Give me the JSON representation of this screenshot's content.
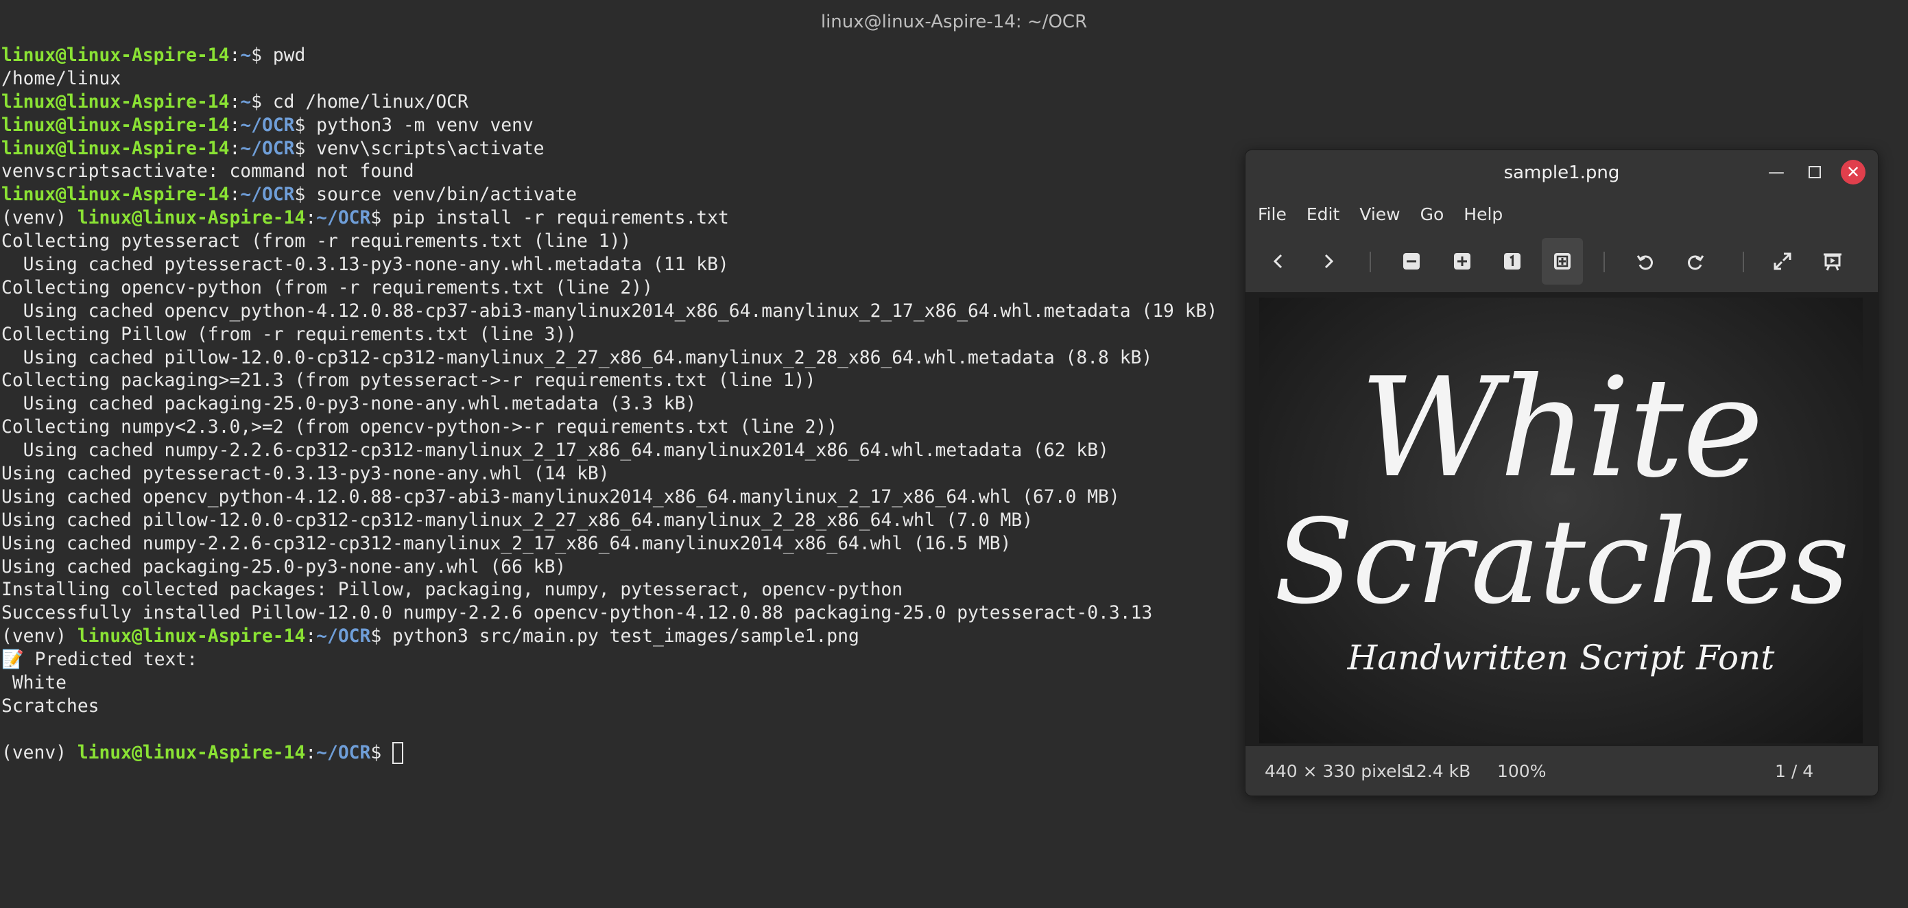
{
  "terminal": {
    "title": "linux@linux-Aspire-14: ~/OCR",
    "lines": [
      {
        "pre": "",
        "user": "linux@linux-Aspire-14",
        "path": "~",
        "cmd": "$ pwd"
      },
      {
        "text": "/home/linux"
      },
      {
        "pre": "",
        "user": "linux@linux-Aspire-14",
        "path": "~",
        "cmd": "$ cd /home/linux/OCR"
      },
      {
        "pre": "",
        "user": "linux@linux-Aspire-14",
        "path": "~/OCR",
        "cmd": "$ python3 -m venv venv"
      },
      {
        "pre": "",
        "user": "linux@linux-Aspire-14",
        "path": "~/OCR",
        "cmd": "$ venv\\scripts\\activate"
      },
      {
        "text": "venvscriptsactivate: command not found"
      },
      {
        "pre": "",
        "user": "linux@linux-Aspire-14",
        "path": "~/OCR",
        "cmd": "$ source venv/bin/activate"
      },
      {
        "pre": "(venv) ",
        "user": "linux@linux-Aspire-14",
        "path": "~/OCR",
        "cmd": "$ pip install -r requirements.txt"
      },
      {
        "text": "Collecting pytesseract (from -r requirements.txt (line 1))"
      },
      {
        "text": "  Using cached pytesseract-0.3.13-py3-none-any.whl.metadata (11 kB)"
      },
      {
        "text": "Collecting opencv-python (from -r requirements.txt (line 2))"
      },
      {
        "text": "  Using cached opencv_python-4.12.0.88-cp37-abi3-manylinux2014_x86_64.manylinux_2_17_x86_64.whl.metadata (19 kB)"
      },
      {
        "text": "Collecting Pillow (from -r requirements.txt (line 3))"
      },
      {
        "text": "  Using cached pillow-12.0.0-cp312-cp312-manylinux_2_27_x86_64.manylinux_2_28_x86_64.whl.metadata (8.8 kB)"
      },
      {
        "text": "Collecting packaging>=21.3 (from pytesseract->-r requirements.txt (line 1))"
      },
      {
        "text": "  Using cached packaging-25.0-py3-none-any.whl.metadata (3.3 kB)"
      },
      {
        "text": "Collecting numpy<2.3.0,>=2 (from opencv-python->-r requirements.txt (line 2))"
      },
      {
        "text": "  Using cached numpy-2.2.6-cp312-cp312-manylinux_2_17_x86_64.manylinux2014_x86_64.whl.metadata (62 kB)"
      },
      {
        "text": "Using cached pytesseract-0.3.13-py3-none-any.whl (14 kB)"
      },
      {
        "text": "Using cached opencv_python-4.12.0.88-cp37-abi3-manylinux2014_x86_64.manylinux_2_17_x86_64.whl (67.0 MB)"
      },
      {
        "text": "Using cached pillow-12.0.0-cp312-cp312-manylinux_2_27_x86_64.manylinux_2_28_x86_64.whl (7.0 MB)"
      },
      {
        "text": "Using cached numpy-2.2.6-cp312-cp312-manylinux_2_17_x86_64.manylinux2014_x86_64.whl (16.5 MB)"
      },
      {
        "text": "Using cached packaging-25.0-py3-none-any.whl (66 kB)"
      },
      {
        "text": "Installing collected packages: Pillow, packaging, numpy, pytesseract, opencv-python"
      },
      {
        "text": "Successfully installed Pillow-12.0.0 numpy-2.2.6 opencv-python-4.12.0.88 packaging-25.0 pytesseract-0.3.13"
      },
      {
        "pre": "(venv) ",
        "user": "linux@linux-Aspire-14",
        "path": "~/OCR",
        "cmd": "$ python3 src/main.py test_images/sample1.png"
      },
      {
        "text": "📝 Predicted text:"
      },
      {
        "text": " White"
      },
      {
        "text": "Scratches"
      },
      {
        "text": ""
      }
    ],
    "prompt": {
      "pre": "(venv) ",
      "user": "linux@linux-Aspire-14",
      "path": "~/OCR",
      "cmd": "$ "
    },
    "colors": {
      "user": "#8ae234",
      "path": "#6f9ed8",
      "text": "#e8e8e8",
      "background": "#2c2c2c"
    }
  },
  "viewer": {
    "title": "sample1.png",
    "menu": [
      "File",
      "Edit",
      "View",
      "Go",
      "Help"
    ],
    "toolbar": [
      "previous-icon",
      "next-icon",
      "zoom-out-icon",
      "zoom-in-icon",
      "zoom-1-to-1-icon",
      "best-fit-icon",
      "rotate-left-icon",
      "rotate-right-icon",
      "fullscreen-icon",
      "slideshow-icon"
    ],
    "image_text": {
      "line1": "White",
      "line2": "Scratches",
      "subtitle": "Handwritten Script Font"
    },
    "status": {
      "dimensions": "440 × 330 pixels",
      "filesize": "12.4 kB",
      "zoom": "100%",
      "page": "1 / 4"
    }
  }
}
